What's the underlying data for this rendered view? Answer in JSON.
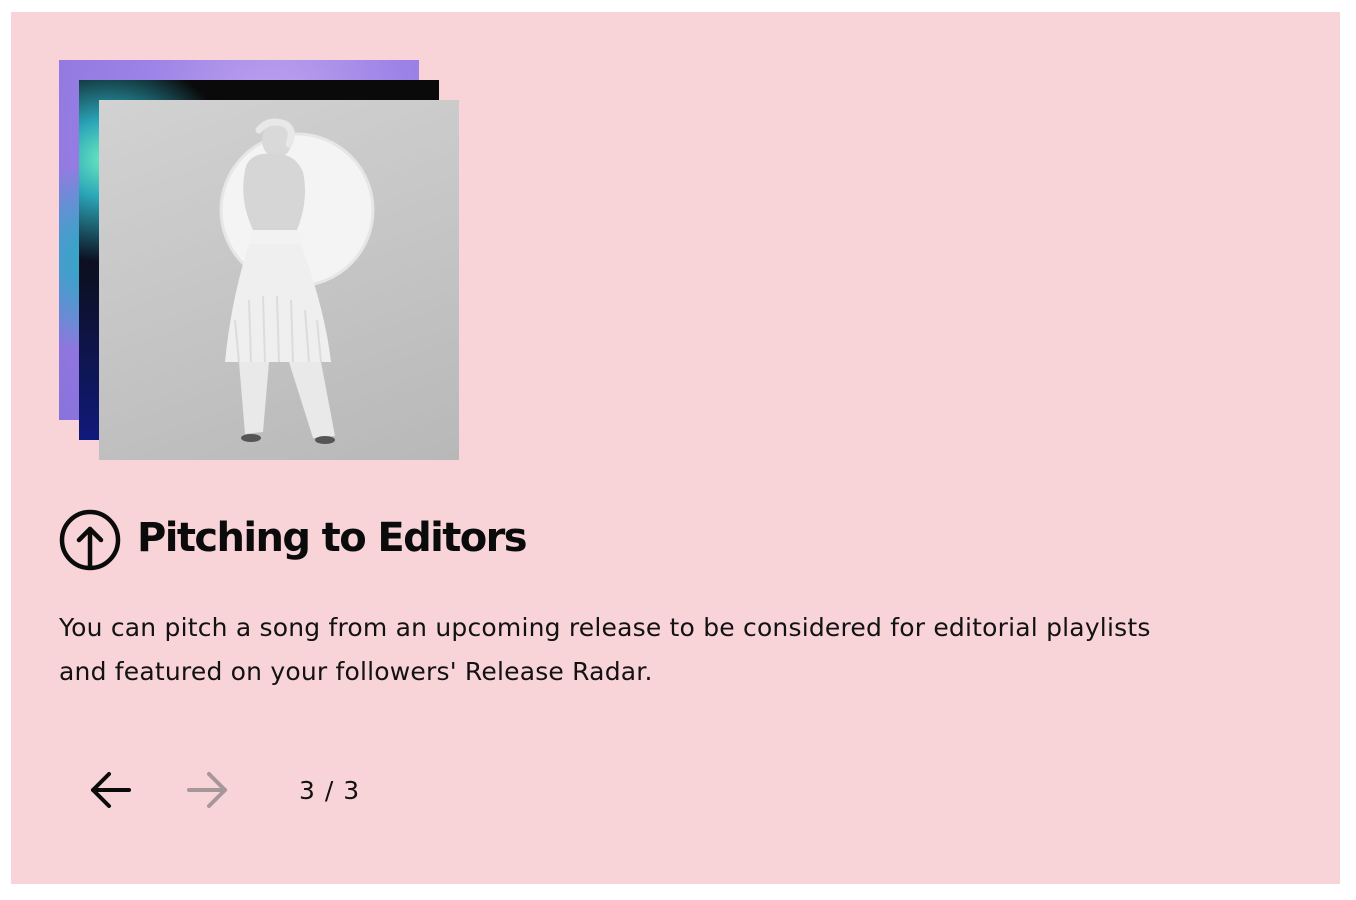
{
  "card": {
    "background": "#f8d3d8",
    "artwork": [
      {
        "name": "album-cover-purple"
      },
      {
        "name": "album-cover-dark"
      },
      {
        "name": "album-cover-white-figure"
      }
    ],
    "title_icon": "arrow-up-circle-icon",
    "title": "Pitching to Editors",
    "description_line1": "You can pitch a song from an upcoming release to be considered for editorial playlists",
    "description_line2": "and featured on your followers' Release Radar.",
    "pager": {
      "prev_icon": "arrow-left-icon",
      "next_icon": "arrow-right-icon",
      "next_disabled": true,
      "count": "3 / 3"
    }
  }
}
